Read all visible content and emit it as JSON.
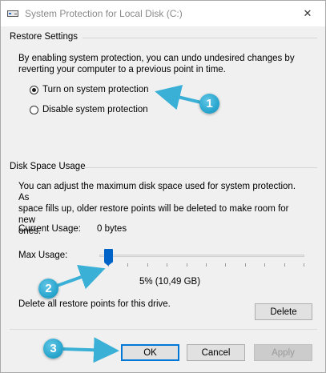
{
  "window": {
    "title": "System Protection for Local Disk (C:)",
    "close_glyph": "✕"
  },
  "restore_settings": {
    "heading": "Restore Settings",
    "description_line1": "By enabling system protection, you can undo undesired changes by",
    "description_line2": "reverting your computer to a previous point in time.",
    "options": [
      {
        "label": "Turn on system protection",
        "checked": true
      },
      {
        "label": "Disable system protection",
        "checked": false
      }
    ]
  },
  "disk_space": {
    "heading": "Disk Space Usage",
    "description_line1": "You can adjust the maximum disk space used for system protection. As",
    "description_line2": "space fills up, older restore points will be deleted to make room for new",
    "description_line3": "ones.",
    "current_usage_label": "Current Usage:",
    "current_usage_value": "0 bytes",
    "max_usage_label": "Max Usage:",
    "max_usage_percent": 5,
    "max_usage_value": "5% (10,49 GB)",
    "delete_text": "Delete all restore points for this drive.",
    "delete_button": "Delete"
  },
  "buttons": {
    "ok": "OK",
    "cancel": "Cancel",
    "apply": "Apply"
  },
  "annotations": [
    {
      "number": "1"
    },
    {
      "number": "2"
    },
    {
      "number": "3"
    }
  ],
  "colors": {
    "slider_thumb": "#0063c7",
    "annotation": "#2aa7cf",
    "primary_border": "#0078d7"
  }
}
